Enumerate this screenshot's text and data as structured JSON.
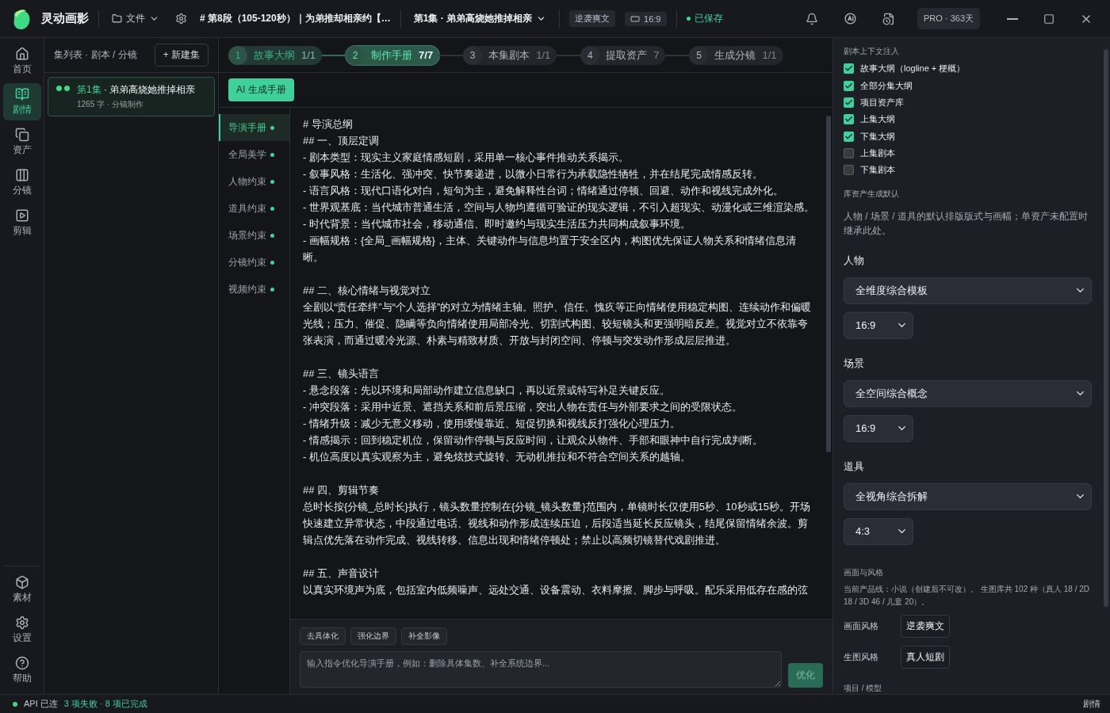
{
  "titlebar": {
    "app_name": "灵动画影",
    "file_menu": "文件",
    "segment_title": "# 第8段（105-120秒）｜为弟推却相亲约【…",
    "episode_select": "第1集 · 弟弟高烧她推掉相亲",
    "style_chip": "逆袭爽文",
    "ratio_chip": "16:9",
    "save_status": "已保存",
    "plan_badge": "PRO · 363天"
  },
  "nav": {
    "items": [
      {
        "label": "首页",
        "selected": false
      },
      {
        "label": "剧情",
        "selected": true
      },
      {
        "label": "资产",
        "selected": false
      },
      {
        "label": "分镜",
        "selected": false
      },
      {
        "label": "剪辑",
        "selected": false
      }
    ],
    "bottom_items": [
      {
        "label": "素材",
        "selected": false
      },
      {
        "label": "设置",
        "selected": false
      },
      {
        "label": "帮助",
        "selected": false
      }
    ]
  },
  "episodes": {
    "title": "集列表 · 剧本 / 分镜",
    "new_button": "+ 新建集",
    "items": [
      {
        "number": "第1集",
        "title": " · 弟弟高烧她推掉相亲",
        "meta": "1265 字 · 分镜制作",
        "selected": true,
        "dots": [
          {
            "color": "#3ddc84"
          },
          {
            "color": "#3ddc84"
          }
        ]
      }
    ]
  },
  "steps": [
    {
      "number": "1",
      "label": "故事大纲",
      "count": "1/1",
      "selected": false,
      "done": true
    },
    {
      "number": "2",
      "label": "制作手册",
      "count": "7/7",
      "selected": true,
      "done": true
    },
    {
      "number": "3",
      "label": "本集剧本",
      "count": "1/1",
      "selected": false,
      "done": false
    },
    {
      "number": "4",
      "label": "提取资产",
      "count": "7",
      "selected": false,
      "done": false
    },
    {
      "number": "5",
      "label": "生成分镜",
      "count": "1/1",
      "selected": false,
      "done": false
    }
  ],
  "generate_button": "AI 生成手册",
  "manual_tabs": [
    {
      "label": "导演手册",
      "selected": true,
      "done": true
    },
    {
      "label": "全局美学",
      "selected": false,
      "done": true
    },
    {
      "label": "人物约束",
      "selected": false,
      "done": true
    },
    {
      "label": "道具约束",
      "selected": false,
      "done": true
    },
    {
      "label": "场景约束",
      "selected": false,
      "done": true
    },
    {
      "label": "分镜约束",
      "selected": false,
      "done": true
    },
    {
      "label": "视频约束",
      "selected": false,
      "done": true
    }
  ],
  "document": [
    {
      "kind": "h1",
      "text": "# 导演总纲"
    },
    {
      "kind": "h2",
      "text": "## 一、顶层定调"
    },
    {
      "kind": "p",
      "text": "- 剧本类型：现实主义家庭情感短剧，采用单一核心事件推动关系揭示。"
    },
    {
      "kind": "p",
      "text": "- 叙事风格：生活化、强冲突、快节奏递进，以微小日常行为承载隐性牺牲，并在结尾完成情感反转。"
    },
    {
      "kind": "p",
      "text": "- 语言风格：现代口语化对白，短句为主，避免解释性台词；情绪通过停顿、回避、动作和视线完成外化。"
    },
    {
      "kind": "p",
      "text": "- 世界观基底：当代城市普通生活，空间与人物均遵循可验证的现实逻辑，不引入超现实、动漫化或三维渲染感。"
    },
    {
      "kind": "p",
      "text": "- 时代背景：当代城市社会，移动通信、即时邀约与现实生活压力共同构成叙事环境。"
    },
    {
      "kind": "p",
      "text": "- 画幅规格：{全局_画幅规格}，主体、关键动作与信息均置于安全区内，构图优先保证人物关系和情绪信息清晰。"
    },
    {
      "kind": "h2",
      "text": "## 二、核心情绪与视觉对立"
    },
    {
      "kind": "p",
      "text": "全剧以“责任牵绊”与“个人选择”的对立为情绪主轴。照护、信任、愧疚等正向情绪使用稳定构图、连续动作和偏暖光线；压力、催促、隐瞒等负向情绪使用局部冷光、切割式构图、较短镜头和更强明暗反差。视觉对立不依靠夸张表演，而通过暖冷光源、朴素与精致材质、开放与封闭空间、停顿与突发动作形成层层推进。"
    },
    {
      "kind": "h2",
      "text": "## 三、镜头语言"
    },
    {
      "kind": "p",
      "text": "- 悬念段落：先以环境和局部动作建立信息缺口，再以近景或特写补足关键反应。"
    },
    {
      "kind": "p",
      "text": "- 冲突段落：采用中近景、遮挡关系和前后景压缩，突出人物在责任与外部要求之间的受限状态。"
    },
    {
      "kind": "p",
      "text": "- 情绪升级：减少无意义移动，使用缓慢靠近、短促切换和视线反打强化心理压力。"
    },
    {
      "kind": "p",
      "text": "- 情感揭示：回到稳定机位，保留动作停顿与反应时间，让观众从物件、手部和眼神中自行完成判断。"
    },
    {
      "kind": "p",
      "text": "- 机位高度以真实观察为主，避免炫技式旋转、无动机推拉和不符合空间关系的越轴。"
    },
    {
      "kind": "h2",
      "text": "## 四、剪辑节奏"
    },
    {
      "kind": "p",
      "text": "总时长按{分镜_总时长}执行，镜头数量控制在{分镜_镜头数量}范围内，单镜时长仅使用5秒、10秒或15秒。开场快速建立异常状态，中段通过电话、视线和动作形成连续压迫，后段适当延长反应镜头，结尾保留情绪余波。剪辑点优先落在动作完成、视线转移、信息出现和情绪停顿处；禁止以高频切镜替代戏剧推进。"
    },
    {
      "kind": "h2",
      "text": "## 五、声音设计"
    },
    {
      "kind": "p",
      "text": "以真实环境声为底，包括室内低频噪声、远处交通、设备震动、衣料摩擦、脚步与呼吸。配乐采用低存在感的弦"
    }
  ],
  "quick_chips": [
    "去具体化",
    "强化边界",
    "补全影像"
  ],
  "refine": {
    "placeholder": "输入指令优化导演手册，例如：删除具体集数、补全系统边界...",
    "button": "优化",
    "disabled": true
  },
  "context": {
    "title": "剧本上下文注入",
    "options": [
      {
        "label": "故事大纲（logline + 梗概）",
        "checked": true
      },
      {
        "label": "全部分集大纲",
        "checked": true
      },
      {
        "label": "项目资产库",
        "checked": true
      },
      {
        "label": "上集大纲",
        "checked": true
      },
      {
        "label": "下集大纲",
        "checked": true
      },
      {
        "label": "上集剧本",
        "checked": false
      },
      {
        "label": "下集剧本",
        "checked": false
      }
    ]
  },
  "asset_defaults": {
    "title": "库资产生成默认",
    "description": "人物 / 场景 / 道具的默认排版版式与画幅；单资产未配置时继承此处。",
    "groups": [
      {
        "label": "人物",
        "template": "全维度综合模板",
        "ratio": "16:9"
      },
      {
        "label": "场景",
        "template": "全空间综合概念",
        "ratio": "16:9"
      },
      {
        "label": "道具",
        "template": "全视角综合拆解",
        "ratio": "4:3"
      }
    ]
  },
  "style": {
    "title": "画面与风格",
    "note": "当前产品线：小说（创建后不可改）。 生图库共 102 种（真人 18 / 2D 18 / 3D 46 / 儿童 20）。",
    "rows": [
      {
        "label": "画面风格",
        "value": "逆袭爽文"
      },
      {
        "label": "生图风格",
        "value": "真人短剧"
      }
    ]
  },
  "next_section": "项目 / 模型",
  "status_bar": {
    "api": "API 已连",
    "tasks": "3 项失败 · 8 项已完成",
    "view": "剧情"
  }
}
